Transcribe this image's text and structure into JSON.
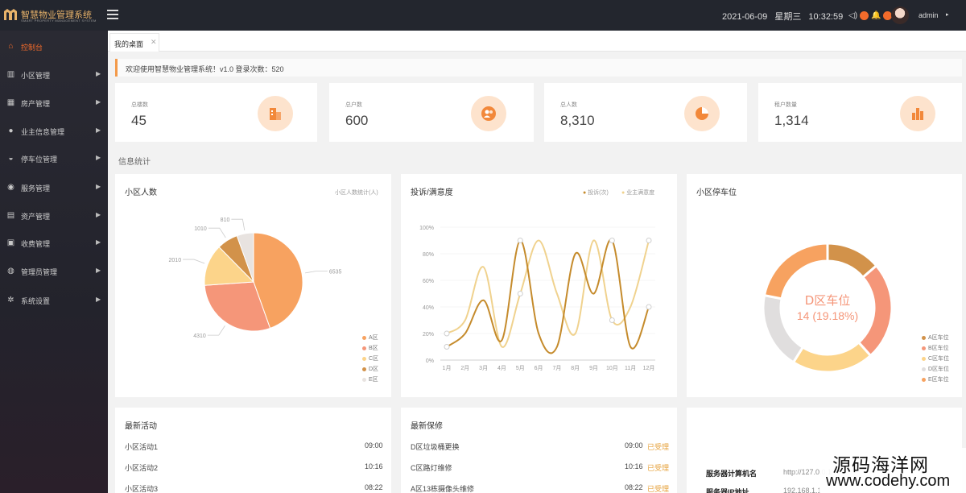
{
  "app": {
    "title": "智慧物业管理系统",
    "subtitle": "SMART PROPERTY MANAGEMENT SYSTEM"
  },
  "header": {
    "date": "2021-06-09",
    "weekday": "星期三",
    "time": "10:32:59",
    "username": "admin"
  },
  "sidebar": {
    "items": [
      {
        "label": "控制台",
        "icon": "home-icon",
        "active": true
      },
      {
        "label": "小区管理",
        "icon": "building-icon"
      },
      {
        "label": "房产管理",
        "icon": "house-icon"
      },
      {
        "label": "业主信息管理",
        "icon": "user-icon"
      },
      {
        "label": "停车位管理",
        "icon": "car-icon"
      },
      {
        "label": "服务管理",
        "icon": "service-icon"
      },
      {
        "label": "资产管理",
        "icon": "asset-icon"
      },
      {
        "label": "收费管理",
        "icon": "fee-icon"
      },
      {
        "label": "管理员管理",
        "icon": "admin-icon"
      },
      {
        "label": "系统设置",
        "icon": "gear-icon"
      }
    ]
  },
  "tabs": [
    {
      "label": "我的桌面"
    }
  ],
  "notice": {
    "text": "欢迎使用智慧物业管理系统！v1.0  登录次数：520"
  },
  "stats": [
    {
      "label": "总楼数",
      "value": "45",
      "icon": "building-icon"
    },
    {
      "label": "总户数",
      "value": "600",
      "icon": "users-icon"
    },
    {
      "label": "总人数",
      "value": "8,310",
      "icon": "pie-icon"
    },
    {
      "label": "租户数量",
      "value": "1,314",
      "icon": "bar-icon"
    }
  ],
  "section": {
    "title": "信息统计"
  },
  "colors": {
    "accent": "#f26b2b",
    "warning": "#e6a23c"
  },
  "chart_data": [
    {
      "type": "pie",
      "title": "小区人数",
      "legend_label": "小区人数统计(人)",
      "categories": [
        "A区",
        "B区",
        "C区",
        "D区",
        "E区"
      ],
      "values": [
        6535,
        4310,
        2010,
        1010,
        810
      ],
      "colors": [
        "#f7a260",
        "#f59679",
        "#fcd48a",
        "#d2924a",
        "#e8e3e0"
      ]
    },
    {
      "type": "line",
      "title": "投诉/满意度",
      "categories": [
        "1月",
        "2月",
        "3月",
        "4月",
        "5月",
        "6月",
        "7月",
        "8月",
        "9月",
        "10月",
        "11月",
        "12月"
      ],
      "ylim": [
        0,
        100
      ],
      "y_ticks": [
        "0%",
        "20%",
        "40%",
        "60%",
        "80%",
        "100%"
      ],
      "series": [
        {
          "name": "投诉(次)",
          "values": [
            10,
            20,
            45,
            15,
            90,
            20,
            10,
            80,
            50,
            90,
            10,
            40
          ],
          "color": "#c58b2c"
        },
        {
          "name": "业主满意度",
          "values": [
            20,
            30,
            70,
            10,
            50,
            90,
            50,
            20,
            90,
            30,
            40,
            90
          ],
          "color": "#f0d28e"
        }
      ]
    },
    {
      "type": "pie",
      "title": "小区停车位",
      "categories": [
        "A区车位",
        "B区车位",
        "C区车位",
        "D区车位",
        "E区车位"
      ],
      "values": [
        10,
        18,
        15,
        14,
        16
      ],
      "colors": [
        "#d2924a",
        "#f59679",
        "#fcd48a",
        "#e0dede",
        "#f7a260"
      ],
      "center_label": "D区车位",
      "center_value": "14 (19.18%)"
    }
  ],
  "activities": {
    "title": "最新活动",
    "rows": [
      {
        "name": "小区活动1",
        "time": "09:00"
      },
      {
        "name": "小区活动2",
        "time": "10:16"
      },
      {
        "name": "小区活动3",
        "time": "08:22"
      }
    ]
  },
  "repairs": {
    "title": "最新保修",
    "rows": [
      {
        "name": "D区垃圾桶更换",
        "time": "09:00",
        "status": "已受理"
      },
      {
        "name": "C区路灯维修",
        "time": "10:16",
        "status": "已受理"
      },
      {
        "name": "A区13栋摄像头维修",
        "time": "08:22",
        "status": "已受理"
      }
    ]
  },
  "server": {
    "rows": [
      {
        "label": "服务器计算机名",
        "value": "http://127.0.0.1"
      },
      {
        "label": "服务器IP地址",
        "value": "192.168.1.1"
      }
    ]
  },
  "watermark": {
    "line1": "源码海洋网",
    "line2": "www.codehy.com"
  }
}
